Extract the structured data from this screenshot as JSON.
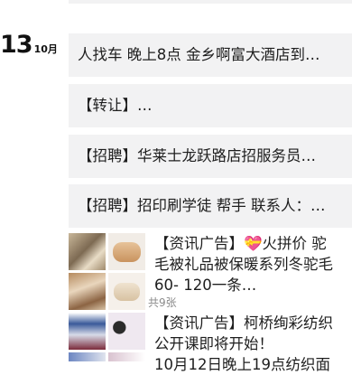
{
  "date": {
    "day": "13",
    "month": "10月"
  },
  "moments": [
    {
      "text": "人找车 晚上8点 金乡啊富大酒店到…"
    },
    {
      "text": "【转让】…"
    },
    {
      "text": "【招聘】华莱士龙跃路店招服务员…"
    },
    {
      "text": "【招聘】招印刷学徒 帮手 联系人：…"
    }
  ],
  "ad_posts": [
    {
      "lines": [
        "【资讯广告】💝火拼价 驼",
        "毛被礼品被保暖系列冬驼毛",
        "60- 120一条…"
      ],
      "image_count": "共9张",
      "thumbnails": [
        "bedding-photo",
        "camel-wool-quilt-photo",
        "bedding-photo",
        "wool-quilt-photo"
      ]
    },
    {
      "lines": [
        "【资讯广告】柯桥绚彩纺织",
        "公开课即将开始！",
        "10月12日晚上19点纺织面"
      ],
      "thumbnails": [
        "event-banner-photo",
        "people-photo",
        "people-photo",
        "people-photo"
      ]
    }
  ]
}
